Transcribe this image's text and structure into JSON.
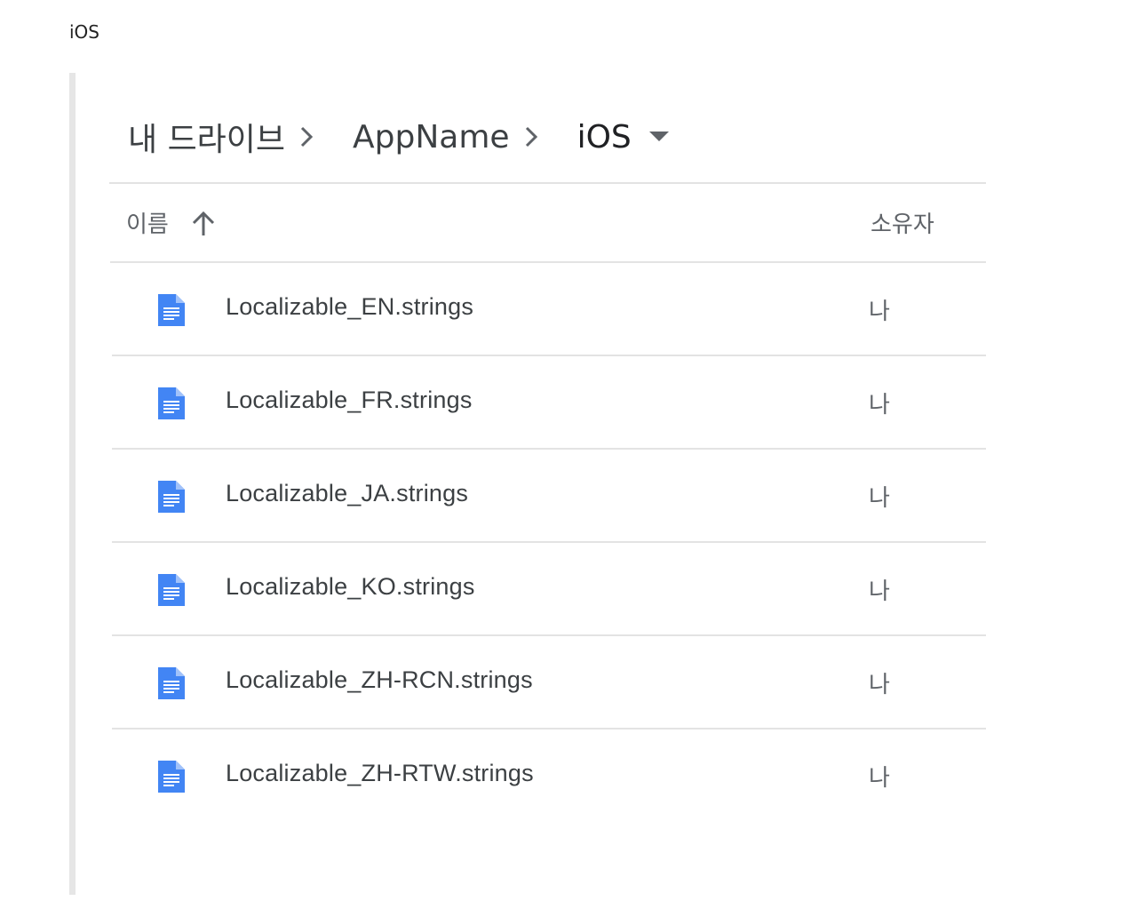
{
  "caption": "iOS",
  "breadcrumb": {
    "items": [
      "내 드라이브",
      "AppName",
      "iOS"
    ],
    "separator_icon": "chevron-right-icon",
    "dropdown_icon": "caret-down-icon"
  },
  "table": {
    "columns": {
      "name": "이름",
      "owner": "소유자"
    },
    "sort_icon": "arrow-up-icon",
    "rows": [
      {
        "name": "Localizable_EN.strings",
        "owner": "나",
        "icon": "document-icon"
      },
      {
        "name": "Localizable_FR.strings",
        "owner": "나",
        "icon": "document-icon"
      },
      {
        "name": "Localizable_JA.strings",
        "owner": "나",
        "icon": "document-icon"
      },
      {
        "name": "Localizable_KO.strings",
        "owner": "나",
        "icon": "document-icon"
      },
      {
        "name": "Localizable_ZH-RCN.strings",
        "owner": "나",
        "icon": "document-icon"
      },
      {
        "name": "Localizable_ZH-RTW.strings",
        "owner": "나",
        "icon": "document-icon"
      }
    ]
  },
  "colors": {
    "doc_icon": "#4285f4",
    "text_primary": "#3c4043",
    "text_secondary": "#5f6368",
    "divider": "#e3e3e3",
    "quote_bar": "#e6e6e6"
  }
}
